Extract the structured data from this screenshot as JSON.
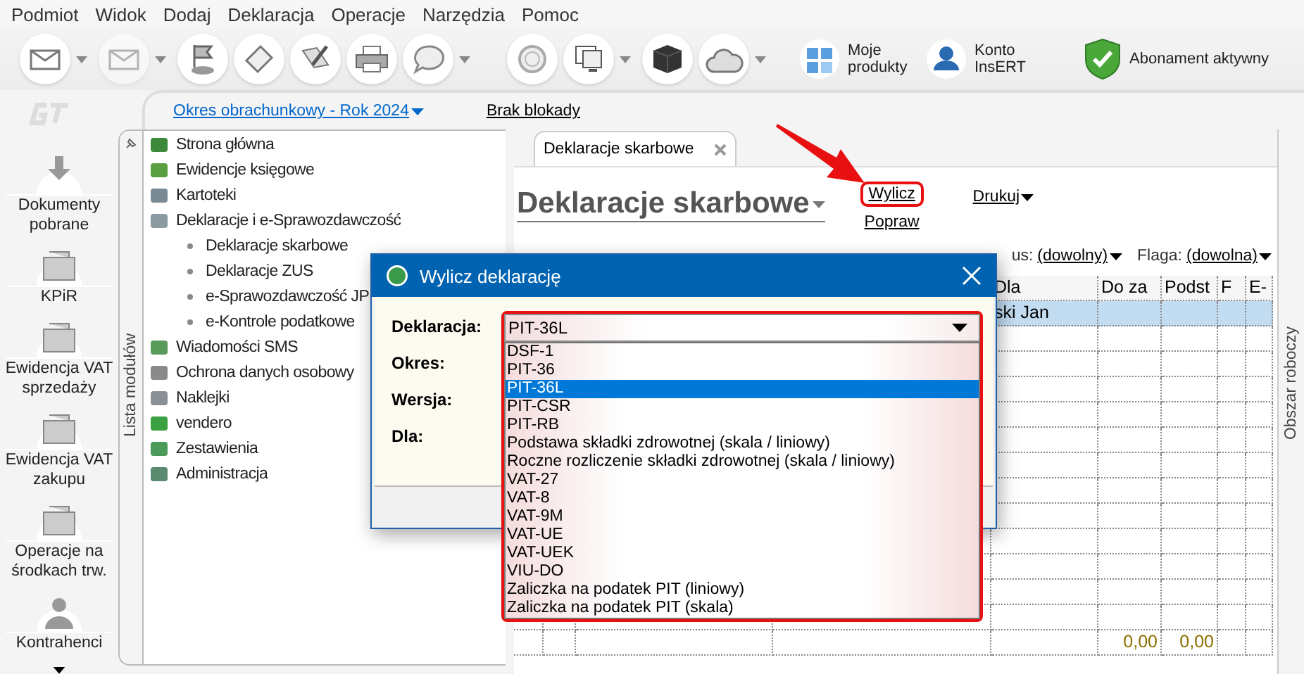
{
  "menu": [
    "Podmiot",
    "Widok",
    "Dodaj",
    "Deklaracja",
    "Operacje",
    "Narzędzia",
    "Pomoc"
  ],
  "toolbar": {
    "buttons": [
      {
        "label": "Moje produkty"
      },
      {
        "label": "Konto InsERT"
      },
      {
        "label": "Abonament aktywny"
      }
    ]
  },
  "left_nav": [
    {
      "label": "Dokumenty pobrane"
    },
    {
      "label": "KPiR"
    },
    {
      "label": "Ewidencja VAT sprzedaży"
    },
    {
      "label": "Ewidencja VAT zakupu"
    },
    {
      "label": "Operacje na środkach trw."
    },
    {
      "label": "Kontrahenci"
    }
  ],
  "top_bar": {
    "period_link": "Okres obrachunkowy - Rok 2024",
    "lock_link": "Brak blokady"
  },
  "modules_panel": {
    "title": "Lista modułów",
    "items": [
      {
        "label": "Strona główna"
      },
      {
        "label": "Ewidencje księgowe"
      },
      {
        "label": "Kartoteki"
      },
      {
        "label": "Deklaracje i e-Sprawozdawczość",
        "children": [
          {
            "label": "Deklaracje skarbowe"
          },
          {
            "label": "Deklaracje ZUS"
          },
          {
            "label": "e-Sprawozdawczość JP"
          },
          {
            "label": "e-Kontrole podatkowe"
          }
        ]
      },
      {
        "label": "Wiadomości SMS"
      },
      {
        "label": "Ochrona danych osobowy"
      },
      {
        "label": "Naklejki"
      },
      {
        "label": "vendero"
      },
      {
        "label": "Zestawienia"
      },
      {
        "label": "Administracja"
      }
    ]
  },
  "tabs": [
    {
      "label": "Deklaracje skarbowe",
      "selected": true
    }
  ],
  "page": {
    "title": "Deklaracje skarbowe",
    "actions": [
      {
        "label": "Wylicz",
        "highlighted": true,
        "dropdown": false
      },
      {
        "label": "Popraw",
        "highlighted": false,
        "dropdown": false
      },
      {
        "label": "Drukuj",
        "highlighted": false,
        "dropdown": true
      }
    ]
  },
  "filters": [
    {
      "label": "us:",
      "value": "(dowolny)"
    },
    {
      "label": "Flaga:",
      "value": "(dowolna)"
    }
  ],
  "table": {
    "columns": [
      "Dla",
      "Do za",
      "Podst",
      "F",
      "E-"
    ],
    "rows": [
      {
        "selected": true,
        "dla": "ski Jan"
      }
    ],
    "totals": {
      "do_za": "0,00",
      "podst": "0,00"
    }
  },
  "workspace_panel": {
    "title": "Obszar roboczy"
  },
  "dialog": {
    "title": "Wylicz deklarację",
    "fields": [
      {
        "label": "Deklaracja:"
      },
      {
        "label": "Okres:"
      },
      {
        "label": "Wersja:"
      },
      {
        "label": "Dla:"
      }
    ],
    "combo": {
      "value": "PIT-36L",
      "expanded": true,
      "highlighted": true,
      "options": [
        {
          "label": "DSF-1",
          "selected": false
        },
        {
          "label": "PIT-36",
          "selected": false
        },
        {
          "label": "PIT-36L",
          "selected": true
        },
        {
          "label": "PIT-CSR",
          "selected": false
        },
        {
          "label": "PIT-RB",
          "selected": false
        },
        {
          "label": "Podstawa składki zdrowotnej (skala / liniowy)",
          "selected": false
        },
        {
          "label": "Roczne rozliczenie składki zdrowotnej (skala / liniowy)",
          "selected": false
        },
        {
          "label": "VAT-27",
          "selected": false
        },
        {
          "label": "VAT-8",
          "selected": false
        },
        {
          "label": "VAT-9M",
          "selected": false
        },
        {
          "label": "VAT-UE",
          "selected": false
        },
        {
          "label": "VAT-UEK",
          "selected": false
        },
        {
          "label": "VIU-DO",
          "selected": false
        },
        {
          "label": "Zaliczka na podatek PIT (liniowy)",
          "selected": false
        },
        {
          "label": "Zaliczka na podatek PIT (skala)",
          "selected": false
        }
      ]
    }
  },
  "annotation": {
    "arrow": true
  }
}
